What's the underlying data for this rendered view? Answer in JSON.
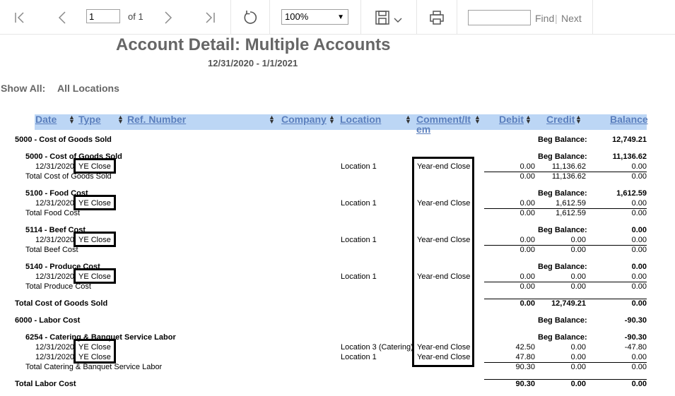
{
  "toolbar": {
    "page_value": "1",
    "of_label": "of 1",
    "zoom_value": "100%",
    "find_value": "",
    "find_label": "Find",
    "separator": "|",
    "next_label": "Next",
    "icons": [
      "first-page-icon",
      "prev-page-icon",
      "next-page-icon",
      "last-page-icon",
      "refresh-icon",
      "save-icon",
      "chevron-down-icon",
      "print-icon"
    ]
  },
  "report": {
    "title": "Account Detail: Multiple Accounts",
    "date_range": "12/31/2020 - 1/1/2021",
    "show_all_label": "Show All:",
    "show_all_value": "All Locations",
    "columns": {
      "date": "Date",
      "type": "Type",
      "ref": "Ref. Number",
      "company": "Company",
      "location": "Location",
      "comment_1": "Comment/It",
      "comment_2": "em",
      "debit": "Debit",
      "credit": "Credit",
      "balance": "Balance"
    },
    "header_color": "#bcd6f5",
    "link_color": "#5b7fbd",
    "groups": {
      "g5000": {
        "title": "5000 - Cost of Goods Sold",
        "beg_label": "Beg Balance:",
        "beg_value": "12,749.21",
        "total_label": "Total Cost of Goods Sold",
        "total_debit": "0.00",
        "total_credit": "12,749.21",
        "total_balance": "0.00"
      },
      "g6000": {
        "title": "6000 - Labor Cost",
        "beg_label": "Beg Balance:",
        "beg_value": "-90.30",
        "total_label": "Total Labor Cost",
        "total_debit": "90.30",
        "total_credit": "0.00",
        "total_balance": "0.00"
      }
    },
    "accounts": {
      "a5000": {
        "title": "5000 - Cost of Goods Sold",
        "beg_label": "Beg Balance:",
        "beg_value": "11,136.62",
        "row": {
          "date": "12/31/2020",
          "type": "YE Close",
          "location": "Location 1",
          "comment": "Year-end Close",
          "debit": "0.00",
          "credit": "11,136.62",
          "balance": "0.00"
        },
        "total_label": "Total Cost of Goods Sold",
        "total_debit": "0.00",
        "total_credit": "11,136.62",
        "total_balance": "0.00"
      },
      "a5100": {
        "title": "5100 - Food Cost",
        "beg_label": "Beg Balance:",
        "beg_value": "1,612.59",
        "row": {
          "date": "12/31/2020",
          "type": "YE Close",
          "location": "Location 1",
          "comment": "Year-end Close",
          "debit": "0.00",
          "credit": "1,612.59",
          "balance": "0.00"
        },
        "total_label": "Total Food Cost",
        "total_debit": "0.00",
        "total_credit": "1,612.59",
        "total_balance": "0.00"
      },
      "a5114": {
        "title": "5114 - Beef Cost",
        "beg_label": "Beg Balance:",
        "beg_value": "0.00",
        "row": {
          "date": "12/31/2020",
          "type": "YE Close",
          "location": "Location 1",
          "comment": "Year-end Close",
          "debit": "0.00",
          "credit": "0.00",
          "balance": "0.00"
        },
        "total_label": "Total Beef Cost",
        "total_debit": "0.00",
        "total_credit": "0.00",
        "total_balance": "0.00"
      },
      "a5140": {
        "title": "5140 - Produce Cost",
        "beg_label": "Beg Balance:",
        "beg_value": "0.00",
        "row": {
          "date": "12/31/2020",
          "type": "YE Close",
          "location": "Location 1",
          "comment": "Year-end Close",
          "debit": "0.00",
          "credit": "0.00",
          "balance": "0.00"
        },
        "total_label": "Total Produce Cost",
        "total_debit": "0.00",
        "total_credit": "0.00",
        "total_balance": "0.00"
      },
      "a6254": {
        "title": "6254 - Catering & Banquet Service Labor",
        "beg_label": "Beg Balance:",
        "beg_value": "-90.30",
        "rows": [
          {
            "date": "12/31/2020",
            "type": "YE Close",
            "location": "Location 3 (Catering)",
            "comment": "Year-end Close",
            "debit": "42.50",
            "credit": "0.00",
            "balance": "-47.80"
          },
          {
            "date": "12/31/2020",
            "type": "YE Close",
            "location": "Location 1",
            "comment": "Year-end Close",
            "debit": "47.80",
            "credit": "0.00",
            "balance": "0.00"
          }
        ],
        "total_label": "Total Catering & Banquet Service Labor",
        "total_debit": "90.30",
        "total_credit": "0.00",
        "total_balance": "0.00"
      }
    }
  }
}
